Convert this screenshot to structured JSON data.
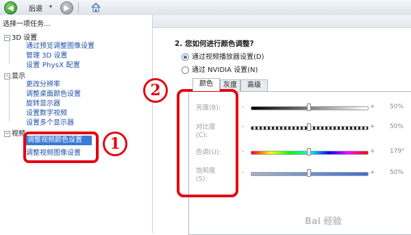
{
  "toolbar": {
    "back_label": "后退",
    "dropdown_glyph": "▾",
    "back_icon": "back-arrow-icon",
    "forward_icon": "forward-arrow-icon",
    "home_icon": "home-icon"
  },
  "left": {
    "task_title": "选择一项任务...",
    "categories": [
      {
        "label": "3D 设置",
        "items": [
          "通过预览调整图像设置",
          "管理 3D 设置",
          "设置 PhysX 配置"
        ]
      },
      {
        "label": "显示",
        "items": [
          "更改分辨率",
          "调整桌面颜色设置",
          "旋转显示器",
          "设置数字视频",
          "设置多个显示器"
        ]
      },
      {
        "label": "视频",
        "items": [
          "调整视频颜色设置",
          "调整视频图像设置"
        ]
      }
    ],
    "annotation_number": "1"
  },
  "right": {
    "section_title": "2. 您如何进行颜色调整?",
    "radio_options": [
      "通过视频播放器设置(D)",
      "通过 NVIDIA 设置(N)"
    ],
    "selected_radio": 0,
    "annotation_number": "2",
    "tabs": [
      "颜色",
      "灰度",
      "高级"
    ],
    "active_tab": 0,
    "sliders": [
      {
        "label": "亮度(B):",
        "value_text": "50%",
        "level": 0.5
      },
      {
        "label": "对比度(C):",
        "value_text": "50%",
        "level": 0.5
      },
      {
        "label": "色调(U):",
        "value_text": "179°",
        "level": 0.5
      },
      {
        "label": "饱和度(S):",
        "value_text": "50%",
        "level": 0.5
      }
    ],
    "slider_minus": "-",
    "slider_plus": "+"
  },
  "watermark": "Bai 经验",
  "colors": {
    "annotation_red": "#e4000f",
    "selection_blue": "#3a7bd5",
    "link_blue": "#2051a8"
  }
}
